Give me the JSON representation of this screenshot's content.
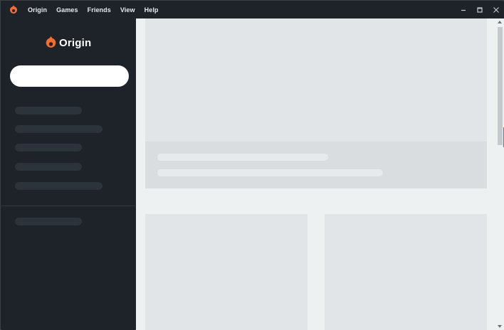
{
  "titlebar": {
    "menu": [
      {
        "label": "Origin"
      },
      {
        "label": "Games"
      },
      {
        "label": "Friends"
      },
      {
        "label": "View"
      },
      {
        "label": "Help"
      }
    ],
    "controls": [
      "minimize-icon",
      "maximize-icon",
      "close-icon"
    ]
  },
  "sidebar": {
    "logo_text": "Origin",
    "search": {
      "value": "",
      "placeholder": ""
    }
  },
  "colors": {
    "brand_orange": "#f56c2d",
    "sidebar_bg": "#1e2329",
    "content_bg": "#eef1f2",
    "placeholder": "#e1e5e8"
  }
}
